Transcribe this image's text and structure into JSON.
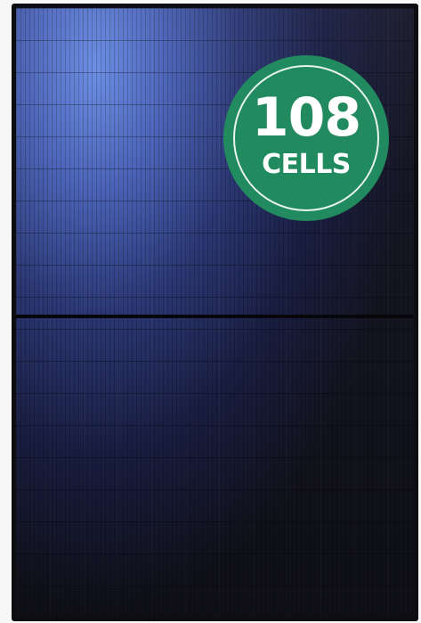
{
  "image": {
    "subject": "solar-panel",
    "badge": {
      "number": "108",
      "label": "CELLS",
      "color": "#218a5f",
      "text_color": "#ffffff"
    },
    "panel_colors": {
      "frame": "#0e0e12",
      "cells_highlight": "#688ce6",
      "cells_dark": "#14141f"
    }
  }
}
